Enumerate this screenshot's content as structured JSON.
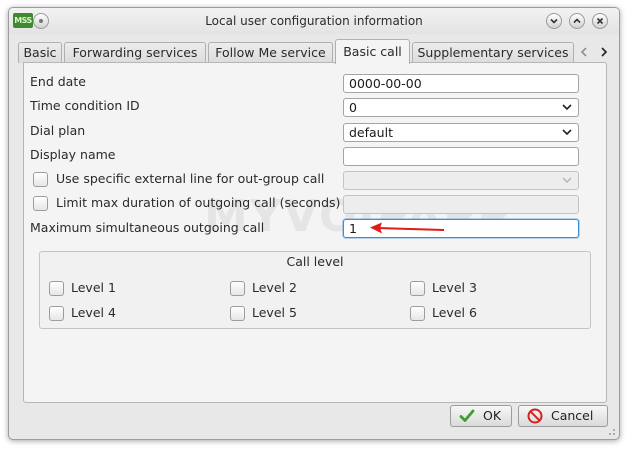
{
  "window": {
    "title": "Local user configuration information",
    "logo_text": "MSS"
  },
  "tabs": [
    {
      "label": "Basic",
      "active": false
    },
    {
      "label": "Forwarding services",
      "active": false
    },
    {
      "label": "Follow Me service",
      "active": false
    },
    {
      "label": "Basic call",
      "active": true
    },
    {
      "label": "Supplementary services",
      "active": false
    }
  ],
  "form": {
    "end_date": {
      "label": "End date",
      "value": "0000-00-00"
    },
    "time_condition_id": {
      "label": "Time condition ID",
      "value": "0"
    },
    "dial_plan": {
      "label": "Dial plan",
      "value": "default"
    },
    "display_name": {
      "label": "Display name",
      "value": ""
    },
    "external_line": {
      "label": "Use specific external line for out-group call",
      "checked": false,
      "value": ""
    },
    "limit_duration": {
      "label": "Limit max duration of outgoing call (seconds)",
      "checked": false,
      "value": ""
    },
    "max_simultaneous": {
      "label": "Maximum simultaneous outgoing call",
      "value": "1"
    }
  },
  "call_level": {
    "title": "Call level",
    "levels": [
      {
        "label": "Level 1",
        "checked": false
      },
      {
        "label": "Level 2",
        "checked": false
      },
      {
        "label": "Level 3",
        "checked": false
      },
      {
        "label": "Level 4",
        "checked": false
      },
      {
        "label": "Level 5",
        "checked": false
      },
      {
        "label": "Level 6",
        "checked": false
      }
    ]
  },
  "buttons": {
    "ok": "OK",
    "cancel": "Cancel"
  },
  "watermark": "MYVOIPAPP",
  "colors": {
    "focus_border": "#3d8fd3",
    "annotation_arrow": "#e01b1b",
    "ok_icon": "#3aa02c",
    "cancel_icon": "#d42020",
    "logo_bg": "#3d8b2f"
  },
  "icons": {
    "minimize": "chevron-down-icon",
    "maximize": "chevron-up-icon",
    "close": "close-icon",
    "tab_prev": "chevron-left-icon",
    "tab_next": "chevron-right-icon",
    "ok": "checkmark-icon",
    "cancel": "no-entry-icon"
  }
}
